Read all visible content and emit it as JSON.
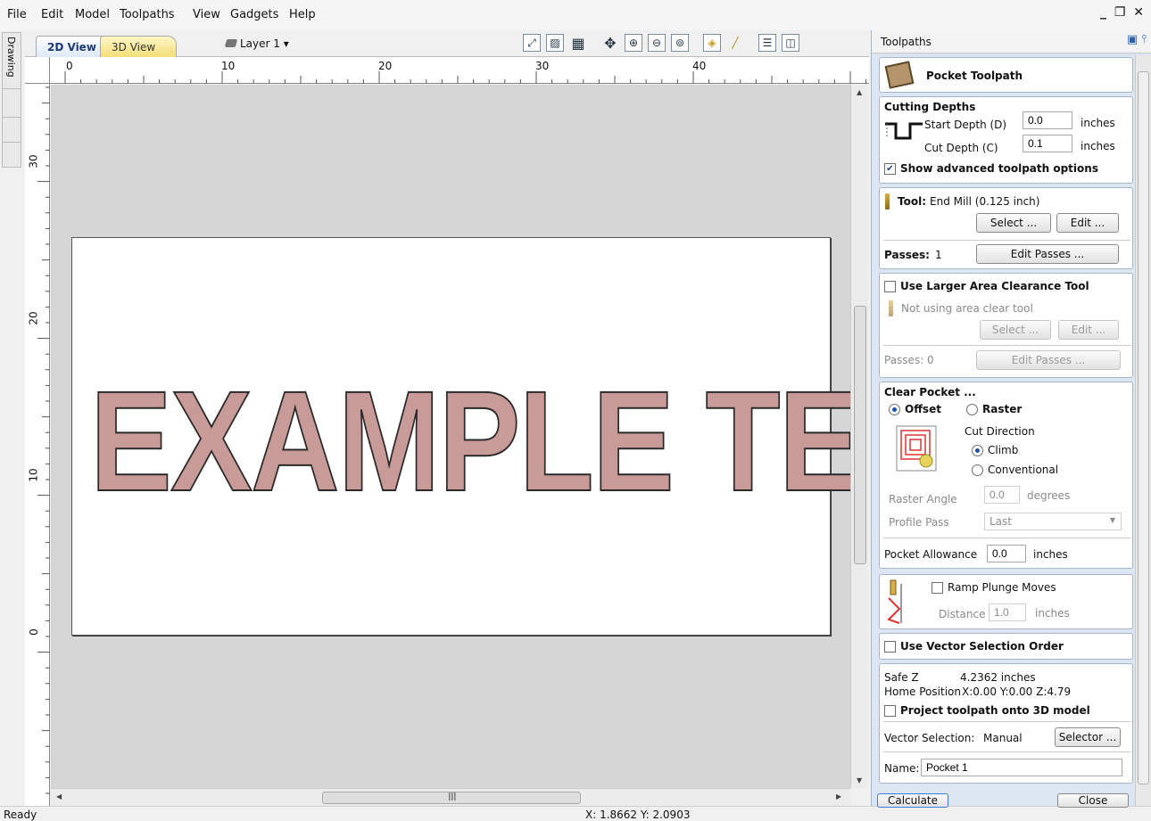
{
  "menu": [
    "File",
    "Edit",
    "Model",
    "Toolpaths",
    "View",
    "Gadgets",
    "Help"
  ],
  "window_controls": "_ &#x1D5D9; ×",
  "side_tab": "Drawing",
  "view_tabs": {
    "tab_2d": "2D View",
    "tab_3d": "3D View"
  },
  "layer": "Layer 1 ▾",
  "toolbar_icons": [
    "zoom-extents-icon",
    "zoom-box-icon",
    "grid-icon",
    "pan-icon",
    "zoom-in-icon",
    "zoom-out-icon",
    "zoom-selection-icon",
    "view-options-icon",
    "tool-icon",
    "split-horizontal-icon",
    "split-vertical-icon"
  ],
  "rulers": {
    "h_labels": [
      "0",
      "10",
      "20",
      "30",
      "40"
    ],
    "v_labels": [
      "30",
      "20",
      "10",
      "0"
    ]
  },
  "canvas_text": "EXAMPLE TEXT",
  "status": {
    "left": "Ready",
    "coords": "X: 1.8662 Y: 2.0903"
  },
  "panel": {
    "title": "Toolpaths",
    "header": "Pocket Toolpath",
    "cutting": {
      "title": "Cutting Depths",
      "start_label": "Start Depth (D)",
      "start_value": "0.0",
      "cut_label": "Cut Depth (C)",
      "cut_value": "0.1",
      "units": "inches",
      "advanced": "Show advanced toolpath options",
      "advanced_checked": true
    },
    "tool": {
      "label": "Tool:",
      "value": "End Mill (0.125 inch)",
      "select": "Select ...",
      "edit": "Edit ...",
      "passes_label": "Passes:",
      "passes_value": "1",
      "edit_passes": "Edit Passes ..."
    },
    "larger": {
      "title": "Use Larger Area Clearance Tool",
      "note": "Not using area clear tool",
      "select": "Select ...",
      "edit": "Edit ...",
      "passes": "Passes:  0",
      "edit_passes": "Edit Passes ..."
    },
    "clear": {
      "title": "Clear Pocket ...",
      "offset": "Offset",
      "raster": "Raster",
      "cut_direction": "Cut Direction",
      "climb": "Climb",
      "conventional": "Conventional",
      "raster_angle_label": "Raster Angle",
      "raster_angle_value": "0.0",
      "degrees": "degrees",
      "profile_label": "Profile Pass",
      "profile_value": "Last",
      "allowance_label": "Pocket Allowance",
      "allowance_value": "0.0",
      "units": "inches"
    },
    "ramp": {
      "label": "Ramp Plunge Moves",
      "distance_label": "Distance",
      "distance_value": "1.0",
      "units": "inches"
    },
    "vector_order": "Use Vector Selection Order",
    "safe": {
      "safe_z_label": "Safe Z",
      "safe_z_value": "4.2362 inches",
      "home_label": "Home Position",
      "home_value": "X:0.00 Y:0.00 Z:4.79",
      "project": "Project toolpath onto 3D model",
      "vector_sel_label": "Vector Selection:",
      "vector_sel_value": "Manual",
      "selector": "Selector ...",
      "name_label": "Name:",
      "name_value": "Pocket 1"
    },
    "calculate": "Calculate",
    "close": "Close"
  }
}
